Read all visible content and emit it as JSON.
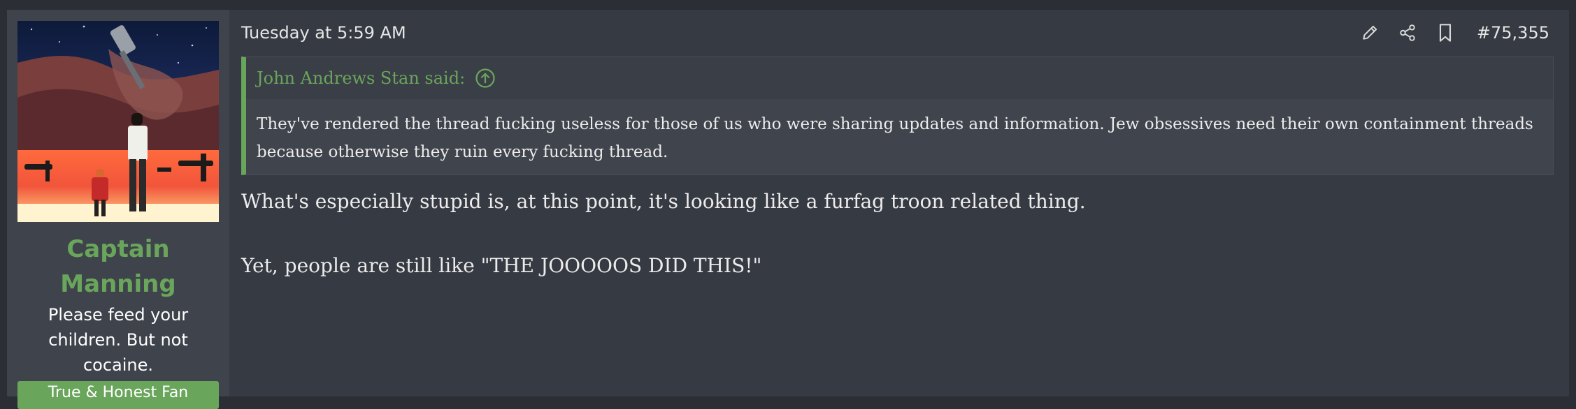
{
  "user": {
    "name": "Captain Manning",
    "title": "Please feed your children. But not cocaine.",
    "banner": "True & Honest Fan"
  },
  "post": {
    "date": "Tuesday at 5:59 AM",
    "number": "#75,355",
    "actions": [
      {
        "icon": "pencil-icon"
      },
      {
        "icon": "share-icon"
      },
      {
        "icon": "bookmark-icon"
      }
    ],
    "quote": {
      "author": "John Andrews Stan said:",
      "text": "They've rendered the thread fucking useless for those of us who were sharing updates and information. Jew obsessives need their own containment threads because otherwise they ruin every fucking thread."
    },
    "message": [
      "What's especially stupid is, at this point, it's looking like a furfag troon related thing.",
      "Yet, people are still like \"THE JOOOOOS DID THIS!\""
    ]
  },
  "colors": {
    "accent": "#6aa55c",
    "page_bg": "#2b2e34",
    "post_bg": "#363a42",
    "user_bg": "#3f434b",
    "quote_bg": "#40444c"
  }
}
